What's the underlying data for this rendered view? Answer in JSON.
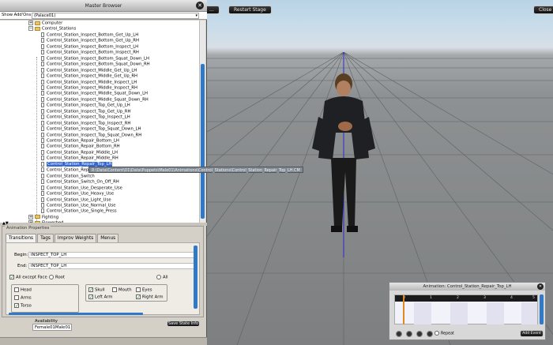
{
  "top_buttons": {
    "restart_label": "Restart Stage",
    "close_label": "Close",
    "left_label": "..."
  },
  "browser": {
    "title": "Master Browser",
    "show_label": "Show Add'Ons",
    "show_value": "(Palace01)",
    "tree": {
      "folders_top": [
        "Computer",
        "Control_Stations"
      ],
      "items": [
        "Control_Station_Inspect_Bottom_Get_Up_LH",
        "Control_Station_Inspect_Bottom_Get_Up_RH",
        "Control_Station_Inspect_Bottom_Inspect_LH",
        "Control_Station_Inspect_Bottom_Inspect_RH",
        "Control_Station_Inspect_Bottom_Squat_Down_LH",
        "Control_Station_Inspect_Bottom_Squat_Down_RH",
        "Control_Station_Inspect_Middle_Get_Up_LH",
        "Control_Station_Inspect_Middle_Get_Up_RH",
        "Control_Station_Inspect_Middle_Inspect_LH",
        "Control_Station_Inspect_Middle_Inspect_RH",
        "Control_Station_Inspect_Middle_Squat_Down_LH",
        "Control_Station_Inspect_Middle_Squat_Down_RH",
        "Control_Station_Inspect_Top_Get_Up_LH",
        "Control_Station_Inspect_Top_Get_Up_RH",
        "Control_Station_Inspect_Top_Inspect_LH",
        "Control_Station_Inspect_Top_Inspect_RH",
        "Control_Station_Inspect_Top_Squat_Down_LH",
        "Control_Station_Inspect_Top_Squat_Down_RH",
        "Control_Station_Repair_Bottom_LH",
        "Control_Station_Repair_Bottom_RH",
        "Control_Station_Repair_Middle_LH",
        "Control_Station_Repair_Middle_RH",
        "Control_Station_Repair_Top_LH",
        "Control_Station_Repair_Top_RH",
        "Control_Station_Switch",
        "Control_Station_Switch_On_Off_RH",
        "Control_Station_Use_Desperate_Use",
        "Control_Station_Use_Heavy_Use",
        "Control_Station_Use_Light_Use",
        "Control_Station_Use_Normal_Use",
        "Control_Station_Use_Single_Press"
      ],
      "folders_bottom": [
        "Fighting",
        "Flowerbed",
        "Gaits"
      ],
      "tooltip": "R:\\Data\\Content\\01\\Data\\Puppets\\Male01\\Animations\\Control_Stations\\Control_Station_Repair_Top_LH.CM"
    }
  },
  "anim_props": {
    "legend": "Animation Properties",
    "tabs": [
      "Transitions",
      "Tags",
      "Improv Weights",
      "Menus"
    ],
    "begin_label": "Begin:",
    "begin_value": "INSPECT_TOP_LH",
    "end_label": "End:",
    "end_value": "INSPECT_TOP_LH",
    "all_except_face": "All except Face",
    "root": "Root",
    "all": "All",
    "head": "Head",
    "arms": "Arms",
    "torso": "Torso",
    "skull": "Skull",
    "mouth": "Mouth",
    "eyes": "Eyes",
    "left_arm": "Left Arm",
    "right_arm": "Right Arm"
  },
  "availability": {
    "label": "Availability",
    "value": "Female01Male01"
  },
  "save_button": "Save State Info",
  "timeline": {
    "title": "Animation: Control_Station_Repair_Top_LH",
    "ticks": [
      "0",
      "1",
      "2",
      "3",
      "4",
      "5"
    ],
    "repeat_label": "Repeat",
    "add_event": "Add Event"
  }
}
